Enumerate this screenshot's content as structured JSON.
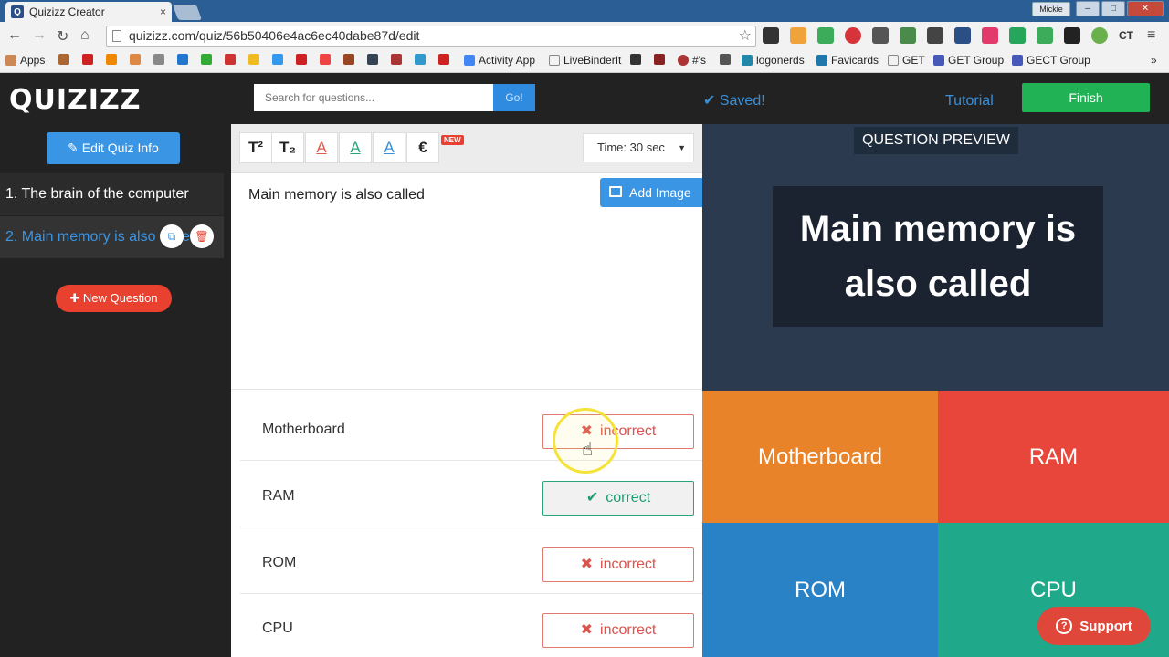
{
  "browser": {
    "tab_title": "Quizizz Creator",
    "tab_favicon": "Q",
    "tab_close": "×",
    "user_badge": "Mickie",
    "url": "quizizz.com/quiz/56b50406e4ac6ec40dabe87d/edit",
    "bookmarks": [
      "Apps",
      "Activity App",
      "LiveBinderIt",
      "#'s",
      "logonerds",
      "Favicards",
      "GET",
      "GET Group",
      "GECT Group"
    ]
  },
  "header": {
    "logo": "QUIZIZZ",
    "search_placeholder": "Search for questions...",
    "go_label": "Go!",
    "saved_label": "✔ Saved!",
    "tutorial_label": "Tutorial",
    "finish_label": "Finish"
  },
  "sidebar": {
    "edit_quiz_label": "Edit Quiz Info",
    "questions": [
      {
        "label": "1.  The brain of the computer"
      },
      {
        "label": "2.  Main memory is also called"
      }
    ],
    "new_question_label": "New Question"
  },
  "editor": {
    "format_buttons": [
      "T²",
      "T₂",
      "A",
      "A",
      "A",
      "€"
    ],
    "format_colors": [
      "#e25a4b",
      "#2aa57b",
      "#3a8fd8"
    ],
    "new_badge": "NEW",
    "time_label": "Time: 30 sec",
    "question_text": "Main memory is also called",
    "add_image_label": "Add Image",
    "answers": [
      {
        "text": "Motherboard",
        "status": "incorrect",
        "mark": "✖"
      },
      {
        "text": "RAM",
        "status": "correct",
        "mark": "✔"
      },
      {
        "text": "ROM",
        "status": "incorrect",
        "mark": "✖"
      },
      {
        "text": "CPU",
        "status": "incorrect",
        "mark": "✖"
      }
    ]
  },
  "preview": {
    "header": "QUESTION PREVIEW",
    "question": "Main memory is also called",
    "tiles": [
      {
        "text": "Motherboard",
        "color": "#e8832a"
      },
      {
        "text": "RAM",
        "color": "#e8463a"
      },
      {
        "text": "ROM",
        "color": "#2a82c6"
      },
      {
        "text": "CPU",
        "color": "#1fa98a"
      }
    ]
  },
  "support_label": "Support"
}
